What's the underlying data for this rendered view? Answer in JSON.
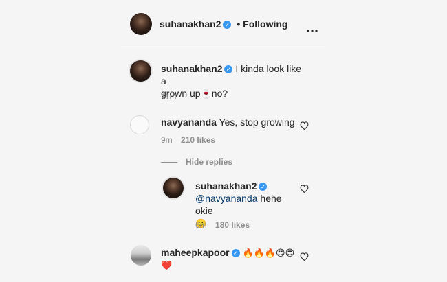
{
  "header": {
    "username": "suhanakhan2",
    "follow_status": "• Following",
    "more_icon": "more-horizontal-icon"
  },
  "caption": {
    "username": "suhanakhan2",
    "text_line1": "I kinda look like a",
    "text_line2": "grown up",
    "emoji": "🍷",
    "text_line2_end": "no?",
    "time": "11m"
  },
  "comments": [
    {
      "username": "navyananda",
      "text": "Yes, stop growing",
      "time": "9m",
      "likes": "210 likes",
      "hide_replies": "Hide replies",
      "replies": [
        {
          "username": "suhanakhan2",
          "mention": "@navyananda",
          "text": "hehe okie",
          "emoji": "🙂",
          "time": "6m",
          "likes": "180 likes"
        }
      ]
    },
    {
      "username": "maheepkapoor",
      "emoji_line1": "🔥🔥🔥😍😍",
      "emoji_line2": "❤️"
    }
  ],
  "colors": {
    "verified": "#3897f0",
    "mention": "#00376b",
    "background": "#f5f5f5"
  }
}
